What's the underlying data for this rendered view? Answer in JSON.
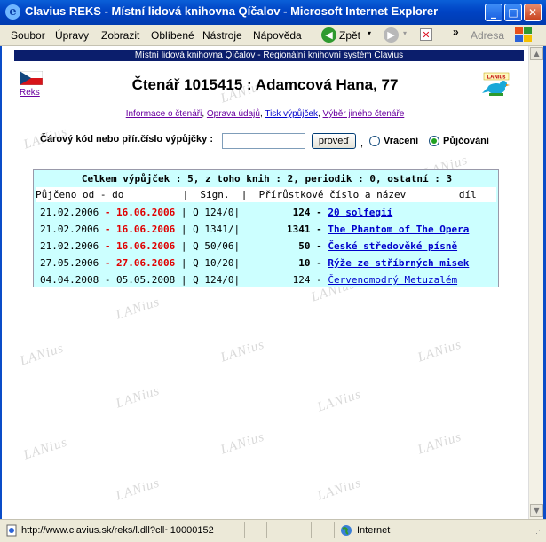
{
  "window": {
    "title": "Clavius REKS - Místní lidová knihovna Qíčalov - Microsoft Internet Explorer",
    "icon": "ie-icon"
  },
  "menu": {
    "items": [
      "Soubor",
      "Úpravy",
      "Zobrazit",
      "Oblíbené",
      "Nástroje",
      "Nápověda"
    ],
    "back_label": "Zpět",
    "address_label": "Adresa",
    "chevron": "»"
  },
  "page": {
    "header_band": "Místní lidová knihovna Qíčalov - Regionální knihovní systém Clavius",
    "reks_link": "Reks",
    "reader_title": "Čtenář 1015415 : Adamcová Hana, 77",
    "links": [
      "Informace o čtenáři",
      "Oprava údajů",
      "Tisk výpůjček",
      "Výběr jiného čtenáře"
    ],
    "barcode_label": "Čárový kód nebo přír.číslo výpůjčky :",
    "barcode_value": "",
    "submit_label": "proveď",
    "comma": ",",
    "radio_return": "Vracení",
    "radio_borrow": "Půjčování",
    "selected_mode": "Půjčování",
    "watermark": "LANius"
  },
  "loans": {
    "summary": "Celkem výpůjček : 5, z toho knih : 2, periodik : 0, ostatní : 3",
    "header": "Půjčeno od - do          |  Sign.  |  Přírůstkové číslo a název         díl",
    "rows": [
      {
        "from": "21.02.2006",
        "to": "16.06.2006",
        "overdue": true,
        "sign": "| Q 124/0|",
        "acc": "124",
        "acc_bold": true,
        "title": "20 solfegií",
        "title_bold": true
      },
      {
        "from": "21.02.2006",
        "to": "16.06.2006",
        "overdue": true,
        "sign": "| Q 1341/|",
        "acc": "1341",
        "acc_bold": true,
        "title": "The Phantom of The Opera",
        "title_bold": true
      },
      {
        "from": "21.02.2006",
        "to": "16.06.2006",
        "overdue": true,
        "sign": "| Q 50/06|",
        "acc": "50",
        "acc_bold": true,
        "title": "České středověké písně",
        "title_bold": true
      },
      {
        "from": "27.05.2006",
        "to": "27.06.2006",
        "overdue": true,
        "sign": "| Q 10/20|",
        "acc": "10",
        "acc_bold": true,
        "title": "Rýže ze stříbrných misek",
        "title_bold": true
      },
      {
        "from": "04.04.2008",
        "to": "05.05.2008",
        "overdue": false,
        "sign": "| Q 124/0|",
        "acc": "124",
        "acc_bold": false,
        "title": "Červenomodrý Metuzalém",
        "title_bold": false
      }
    ]
  },
  "status": {
    "url": "http://www.clavius.sk/reks/l.dll?cll~10000152",
    "zone": "Internet"
  },
  "colors": {
    "title_bar": "#0043c4",
    "header_band": "#0b1e6c",
    "loan_bg": "#ccffff",
    "overdue": "#e00000",
    "link": "#0000cc",
    "visited": "#6a00a0"
  }
}
